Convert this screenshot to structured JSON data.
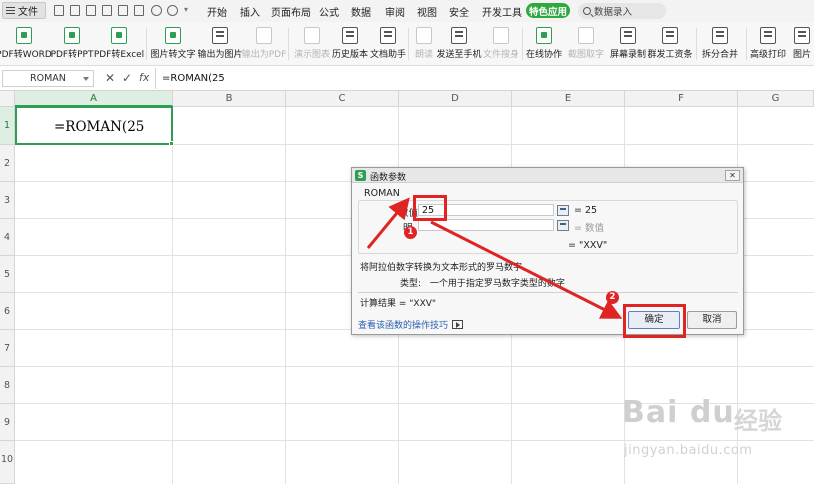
{
  "menubar": {
    "file_label": "文件",
    "tabs": [
      "开始",
      "插入",
      "页面布局",
      "公式",
      "数据",
      "审阅",
      "视图",
      "安全",
      "开发工具"
    ],
    "special_tab": "特色应用",
    "search_placeholder": "数据录入"
  },
  "toolbar": {
    "buttons": [
      {
        "label": "PDF转WORD",
        "enabled": true
      },
      {
        "label": "PDF转PPT",
        "enabled": true
      },
      {
        "label": "PDF转Excel",
        "enabled": true
      },
      {
        "label": "图片转文字",
        "enabled": true
      },
      {
        "label": "输出为图片",
        "enabled": true
      },
      {
        "label": "输出为PDF",
        "enabled": false
      },
      {
        "label": "演示图表",
        "enabled": false
      },
      {
        "label": "历史版本",
        "enabled": true
      },
      {
        "label": "文档助手",
        "enabled": true
      },
      {
        "label": "朗读",
        "enabled": false
      },
      {
        "label": "发送至手机",
        "enabled": true
      },
      {
        "label": "文件搜身",
        "enabled": false
      },
      {
        "label": "在线协作",
        "enabled": true
      },
      {
        "label": "截图取字",
        "enabled": false
      },
      {
        "label": "屏幕录制",
        "enabled": true
      },
      {
        "label": "群发工资条",
        "enabled": true
      },
      {
        "label": "拆分合并",
        "enabled": true
      },
      {
        "label": "高级打印",
        "enabled": true
      },
      {
        "label": "图片",
        "enabled": true
      }
    ]
  },
  "formula_bar": {
    "name_box": "ROMAN",
    "cancel_symbol": "✕",
    "confirm_symbol": "✓",
    "fx_symbol": "fx",
    "formula": "=ROMAN(25"
  },
  "sheet": {
    "columns": [
      "A",
      "B",
      "C",
      "D",
      "E",
      "F",
      "G"
    ],
    "rows": [
      "1",
      "2",
      "3",
      "4",
      "5",
      "6",
      "7",
      "8",
      "9",
      "10"
    ],
    "active_cell_text": "=ROMAN(25"
  },
  "dialog": {
    "title": "函数参数",
    "logo": "S",
    "close": "✕",
    "function_name": "ROMAN",
    "args": [
      {
        "label": "数值",
        "value": "25",
        "result": "= 25"
      },
      {
        "label": "明",
        "value": "",
        "result": "= 数值"
      }
    ],
    "formula_result": "= \"XXV\"",
    "description": "将阿拉伯数字转换为文本形式的罗马数字。",
    "type_label": "类型:",
    "type_desc": "一个用于指定罗马数字类型的数字",
    "calc_result": "计算结果 = \"XXV\"",
    "help_link": "查看该函数的操作技巧",
    "ok": "确定",
    "cancel": "取消"
  },
  "annotations": {
    "badge1": "1",
    "badge2": "2",
    "color": "#e02424"
  },
  "watermark": {
    "logo": "Bai du",
    "cn": "经验",
    "url": "jingyan.baidu.com"
  }
}
